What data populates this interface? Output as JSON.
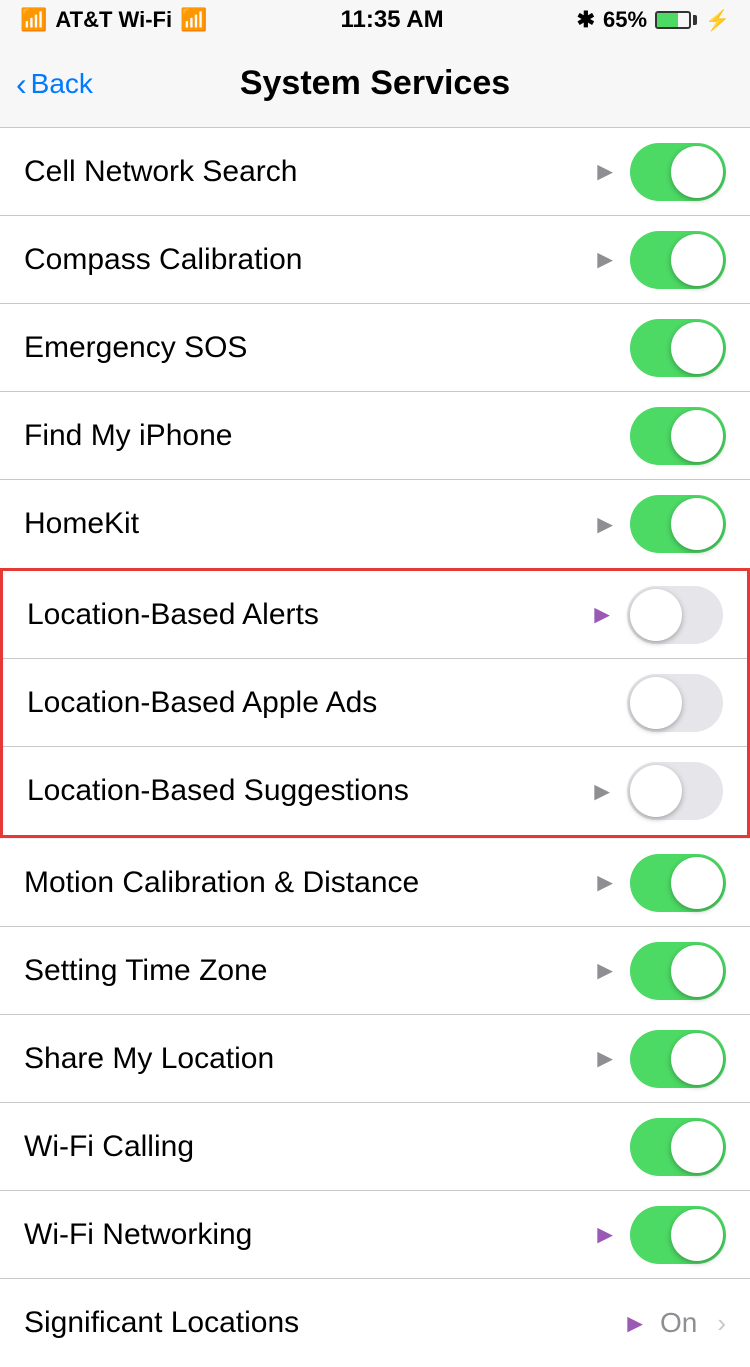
{
  "statusBar": {
    "carrier": "AT&T Wi-Fi",
    "time": "11:35 AM",
    "battery": "65%",
    "wifiIcon": "wifi",
    "bluetoothIcon": "bluetooth",
    "batteryCharging": true
  },
  "navBar": {
    "backLabel": "Back",
    "title": "System Services"
  },
  "items": [
    {
      "id": "cell-network-search",
      "label": "Cell Network Search",
      "hasArrow": true,
      "arrowColor": "gray",
      "toggleState": "on",
      "partial": true
    },
    {
      "id": "compass-calibration",
      "label": "Compass Calibration",
      "hasArrow": true,
      "arrowColor": "gray",
      "toggleState": "on",
      "partial": false
    },
    {
      "id": "emergency-sos",
      "label": "Emergency SOS",
      "hasArrow": false,
      "arrowColor": "",
      "toggleState": "on",
      "partial": false
    },
    {
      "id": "find-my-iphone",
      "label": "Find My iPhone",
      "hasArrow": false,
      "arrowColor": "",
      "toggleState": "on",
      "partial": false
    },
    {
      "id": "homekit",
      "label": "HomeKit",
      "hasArrow": true,
      "arrowColor": "gray",
      "toggleState": "on",
      "partial": false
    }
  ],
  "highlightedItems": [
    {
      "id": "location-based-alerts",
      "label": "Location-Based Alerts",
      "hasArrow": true,
      "arrowColor": "purple",
      "toggleState": "off",
      "partial": false
    },
    {
      "id": "location-based-apple-ads",
      "label": "Location-Based Apple Ads",
      "hasArrow": false,
      "arrowColor": "",
      "toggleState": "off",
      "partial": false
    },
    {
      "id": "location-based-suggestions",
      "label": "Location-Based Suggestions",
      "hasArrow": true,
      "arrowColor": "gray",
      "toggleState": "off",
      "partial": false
    }
  ],
  "bottomItems": [
    {
      "id": "motion-calibration",
      "label": "Motion Calibration & Distance",
      "hasArrow": true,
      "arrowColor": "gray",
      "toggleState": "on",
      "isSignificantLocations": false
    },
    {
      "id": "setting-time-zone",
      "label": "Setting Time Zone",
      "hasArrow": true,
      "arrowColor": "gray",
      "toggleState": "on",
      "isSignificantLocations": false
    },
    {
      "id": "share-my-location",
      "label": "Share My Location",
      "hasArrow": true,
      "arrowColor": "gray",
      "toggleState": "on",
      "isSignificantLocations": false
    },
    {
      "id": "wifi-calling",
      "label": "Wi-Fi Calling",
      "hasArrow": false,
      "arrowColor": "",
      "toggleState": "on",
      "isSignificantLocations": false
    },
    {
      "id": "wifi-networking",
      "label": "Wi-Fi Networking",
      "hasArrow": true,
      "arrowColor": "purple",
      "toggleState": "on",
      "isSignificantLocations": false
    },
    {
      "id": "significant-locations",
      "label": "Significant Locations",
      "hasArrow": true,
      "arrowColor": "purple",
      "toggleState": "value",
      "value": "On",
      "isSignificantLocations": true
    }
  ],
  "colors": {
    "green": "#4cd964",
    "blue": "#007aff",
    "gray": "#8e8e93",
    "purple": "#9b59b6",
    "red": "#e53935"
  }
}
